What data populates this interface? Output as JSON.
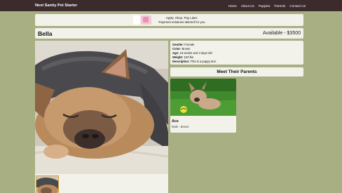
{
  "nav": {
    "brand": "Next Sanity Pet Starter",
    "links": [
      "Home",
      "About Us",
      "Puppies",
      "Parents",
      "Contact Us"
    ]
  },
  "banner": {
    "line1": "Apply. Shop. Pay Later.",
    "line2": "Payment solutions tailored for you"
  },
  "pet": {
    "name": "Bella",
    "price": "Available - $3500",
    "details": [
      {
        "label": "Gender:",
        "value": "Female"
      },
      {
        "label": "Color:",
        "value": "Brown"
      },
      {
        "label": "Age:",
        "value": "16 weeks and 3 days old"
      },
      {
        "label": "Weight:",
        "value": "102 lbs"
      },
      {
        "label": "Description:",
        "value": "This is a puppy text."
      }
    ]
  },
  "parents": {
    "heading": "Meet Their Parents",
    "cards": [
      {
        "name": "Ace",
        "meta": "Male - Brown"
      }
    ]
  },
  "colors": {
    "page_background": "#a8af82",
    "navbar": "#3b2b2d",
    "panel": "#f2f2ea",
    "thumb_active_border": "#d9a233"
  }
}
